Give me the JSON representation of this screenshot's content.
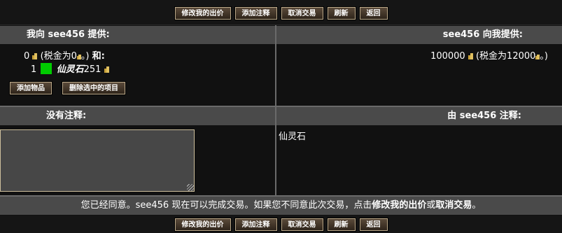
{
  "toolbar": {
    "modify_offer": "修改我的出价",
    "add_note": "添加注释",
    "cancel_trade": "取消交易",
    "refresh": "刷新",
    "back": "返回"
  },
  "left_panel": {
    "header": "我向 see456 提供:",
    "gold_amount": "0",
    "tax_prefix": "(税金为0",
    "tax_suffix": "。)",
    "and_label": "和:",
    "item_qty": "1",
    "item_name": "仙灵石",
    "item_price": "251",
    "add_item_button": "添加物品",
    "remove_selected_button": "删除选中的项目"
  },
  "right_panel": {
    "header": "see456 向我提供:",
    "gold_amount": "100000",
    "tax_prefix": "(税金为12000",
    "tax_suffix": "。)"
  },
  "notes": {
    "left_header": "没有注释:",
    "right_header": "由 see456 注释:",
    "right_note_text": "仙灵石",
    "textarea_value": ""
  },
  "footer": {
    "part1": "您已经同意。see456 现在可以完成交易。如果您不同意此次交易，点击",
    "link1": "修改我的出价",
    "part2": "或",
    "link2": "取消交易",
    "part3": "。"
  },
  "colors": {
    "background": "#111111",
    "header_bg": "#4a4a4a",
    "button_border": "#bba98a",
    "item_icon": "#00cc00",
    "coin": "#e0c060"
  },
  "icons": [
    "gold-coin-icon",
    "item-green-square-icon",
    "resize-grip-icon"
  ]
}
